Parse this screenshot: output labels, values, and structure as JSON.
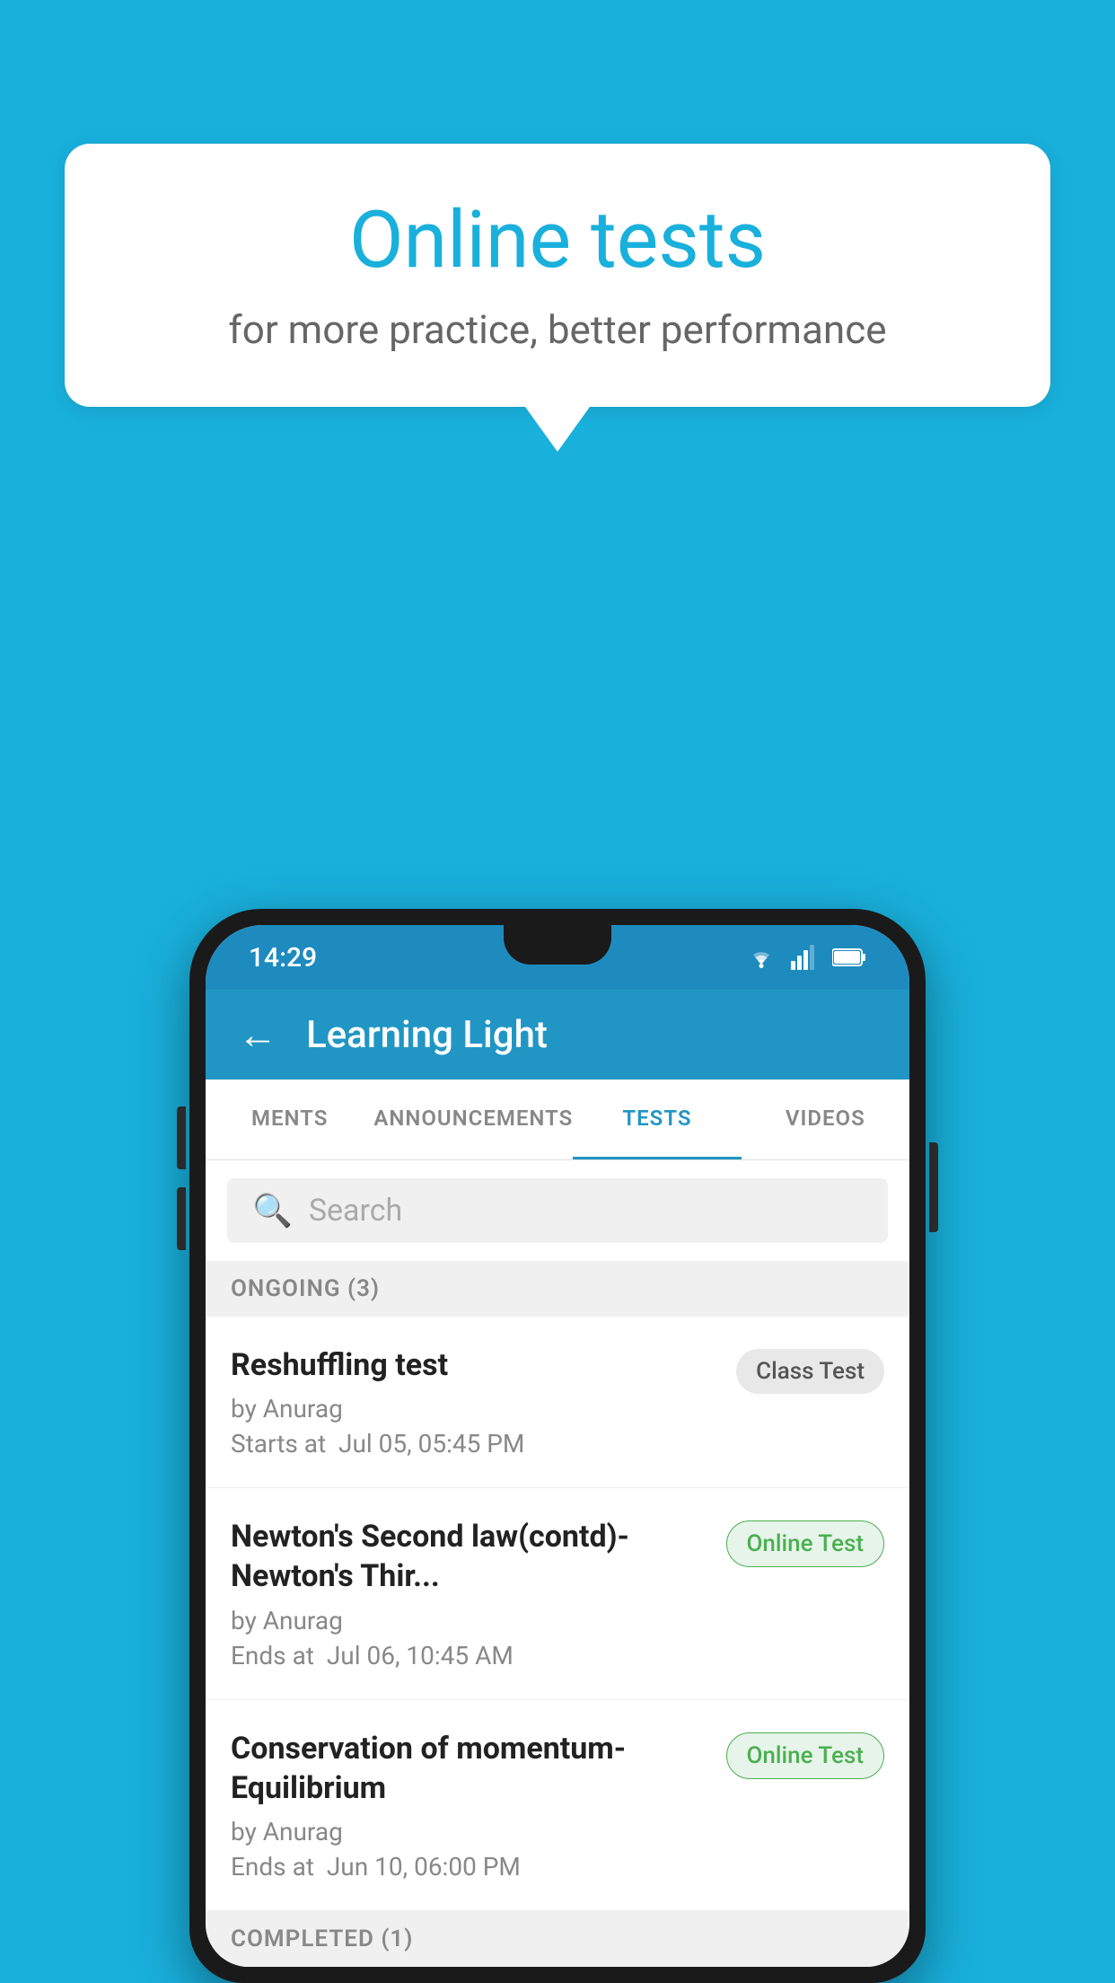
{
  "background_color": "#19b0dc",
  "speech_bubble": {
    "title": "Online tests",
    "subtitle": "for more practice, better performance"
  },
  "phone": {
    "status_bar": {
      "time": "14:29"
    },
    "header": {
      "title": "Learning Light",
      "back_label": "←"
    },
    "tabs": [
      {
        "label": "MENTS",
        "active": false
      },
      {
        "label": "ANNOUNCEMENTS",
        "active": false
      },
      {
        "label": "TESTS",
        "active": true
      },
      {
        "label": "VIDEOS",
        "active": false
      }
    ],
    "search": {
      "placeholder": "Search"
    },
    "ongoing_section": {
      "label": "ONGOING (3)"
    },
    "tests": [
      {
        "name": "Reshuffling test",
        "author": "by Anurag",
        "time_label": "Starts at",
        "time": "Jul 05, 05:45 PM",
        "badge": "Class Test",
        "badge_type": "class"
      },
      {
        "name": "Newton's Second law(contd)-Newton's Thir...",
        "author": "by Anurag",
        "time_label": "Ends at",
        "time": "Jul 06, 10:45 AM",
        "badge": "Online Test",
        "badge_type": "online"
      },
      {
        "name": "Conservation of momentum-Equilibrium",
        "author": "by Anurag",
        "time_label": "Ends at",
        "time": "Jun 10, 06:00 PM",
        "badge": "Online Test",
        "badge_type": "online"
      }
    ],
    "completed_section": {
      "label": "COMPLETED (1)"
    }
  }
}
